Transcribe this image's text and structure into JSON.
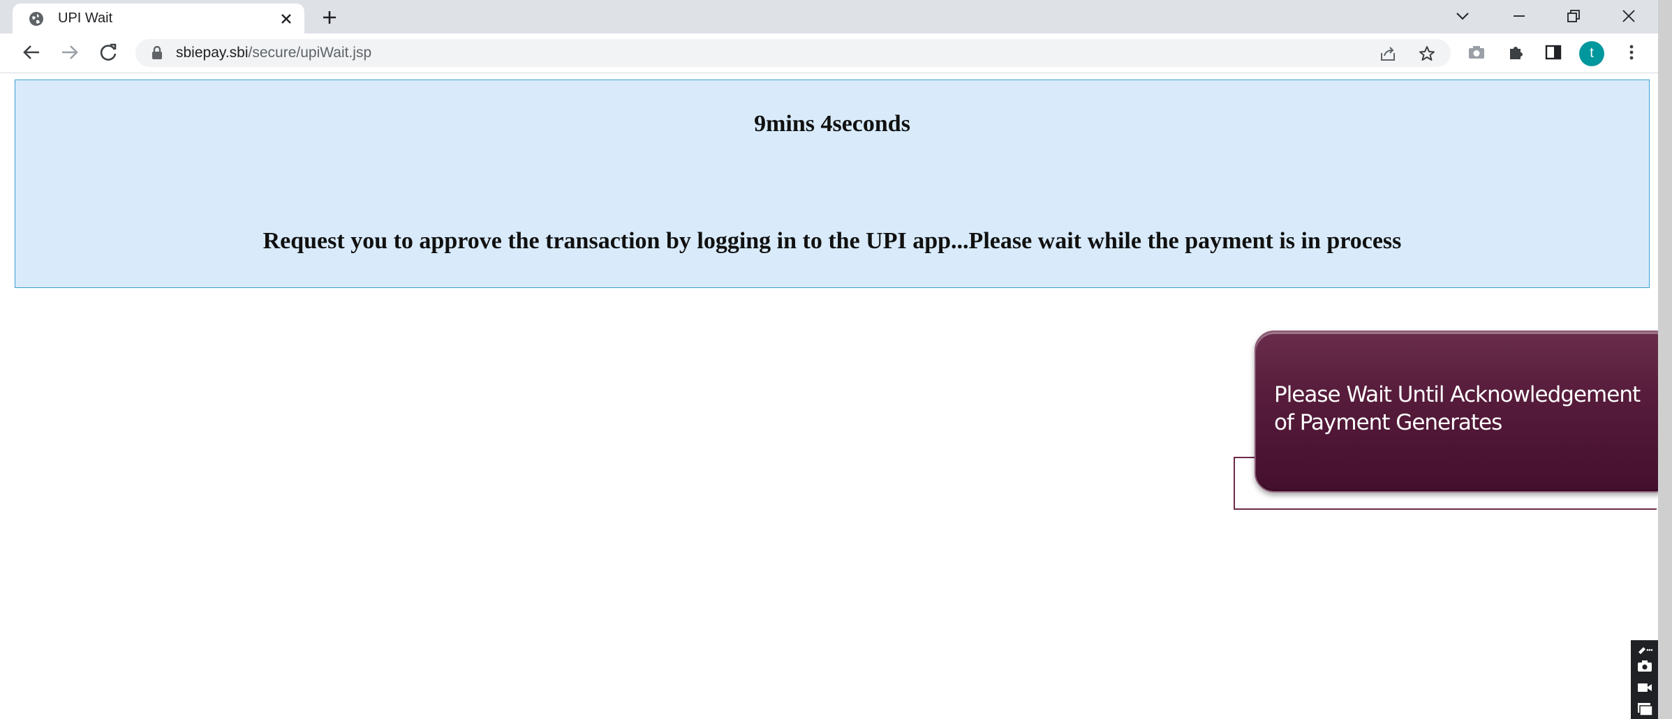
{
  "browser": {
    "tab_title": "UPI Wait",
    "url_host": "sbiepay.sbi",
    "url_path": "/secure/upiWait.jsp",
    "profile_initial": "t",
    "icons": [
      "globe-icon",
      "close-icon",
      "plus-icon",
      "chevron-down-icon",
      "minimize-icon",
      "restore-icon",
      "window-close-icon",
      "back-icon",
      "forward-icon",
      "reload-icon",
      "lock-icon",
      "share-icon",
      "star-icon",
      "camera-icon",
      "puzzle-icon",
      "side-panel-icon",
      "kebab-menu-icon"
    ]
  },
  "page": {
    "timer": "9mins 4seconds",
    "message": "Request you to approve the transaction by logging in to the UPI app...Please wait while the payment is in process"
  },
  "callout": {
    "text_line1": "Please Wait Until Acknowledgement",
    "text_line2": "of Payment Generates"
  },
  "colors": {
    "wait_box_bg": "#d9ebfb",
    "wait_box_border": "#3aa0d0",
    "callout_bg": "#571c3b",
    "avatar": "#00979d"
  }
}
